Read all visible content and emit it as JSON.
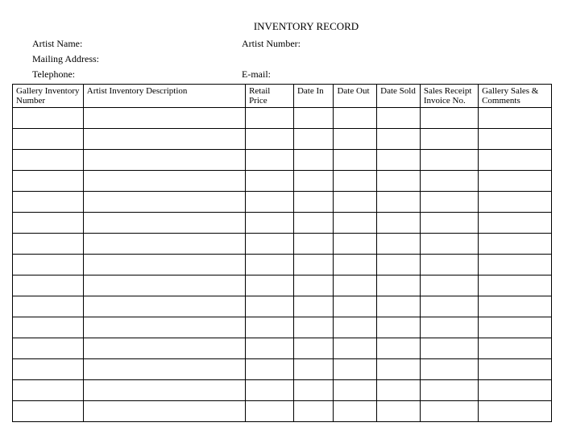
{
  "title": "INVENTORY RECORD",
  "fields": {
    "artist_name_label": "Artist Name:",
    "artist_number_label": "Artist Number:",
    "mailing_address_label": "Mailing Address:",
    "telephone_label": "Telephone:",
    "email_label": "E-mail:"
  },
  "columns": {
    "c1": "Gallery Inventory Number",
    "c2": "Artist Inventory Description",
    "c3": "Retail Price",
    "c4": "Date In",
    "c5": "Date Out",
    "c6": "Date Sold",
    "c7": "Sales Receipt Invoice No.",
    "c8": "Gallery Sales & Comments"
  },
  "row_count": 15
}
